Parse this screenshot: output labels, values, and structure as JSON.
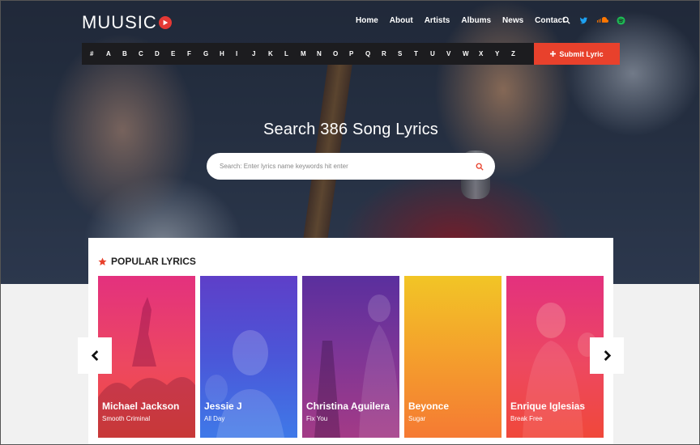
{
  "brand": {
    "logo_text": "MUUSIC"
  },
  "nav": {
    "items": [
      "Home",
      "About",
      "Artists",
      "Albums",
      "News",
      "Contact"
    ]
  },
  "nav_icons": [
    "search-icon",
    "twitter-icon",
    "soundcloud-icon",
    "spotify-icon"
  ],
  "alphabet": [
    "#",
    "A",
    "B",
    "C",
    "D",
    "E",
    "F",
    "G",
    "H",
    "I",
    "J",
    "K",
    "L",
    "M",
    "N",
    "O",
    "P",
    "Q",
    "R",
    "S",
    "T",
    "U",
    "V",
    "W",
    "X",
    "Y",
    "Z"
  ],
  "submit": {
    "label": "Submit Lyric"
  },
  "search": {
    "title": "Search 386 Song Lyrics",
    "placeholder": "Search: Enter lyrics name keywords hit enter"
  },
  "popular": {
    "title": "POPULAR LYRICS",
    "cards": [
      {
        "artist": "Michael Jackson",
        "song": "Smooth Criminal"
      },
      {
        "artist": "Jessie J",
        "song": "All Day"
      },
      {
        "artist": "Christina Aguilera",
        "song": "Fix You"
      },
      {
        "artist": "Beyonce",
        "song": "Sugar"
      },
      {
        "artist": "Enrique Iglesias",
        "song": "Break Free"
      }
    ]
  },
  "colors": {
    "accent": "#e8412c",
    "dark_bar": "#1c1c1f",
    "twitter": "#1da1f2",
    "soundcloud": "#ff7700",
    "spotify": "#1db954"
  }
}
